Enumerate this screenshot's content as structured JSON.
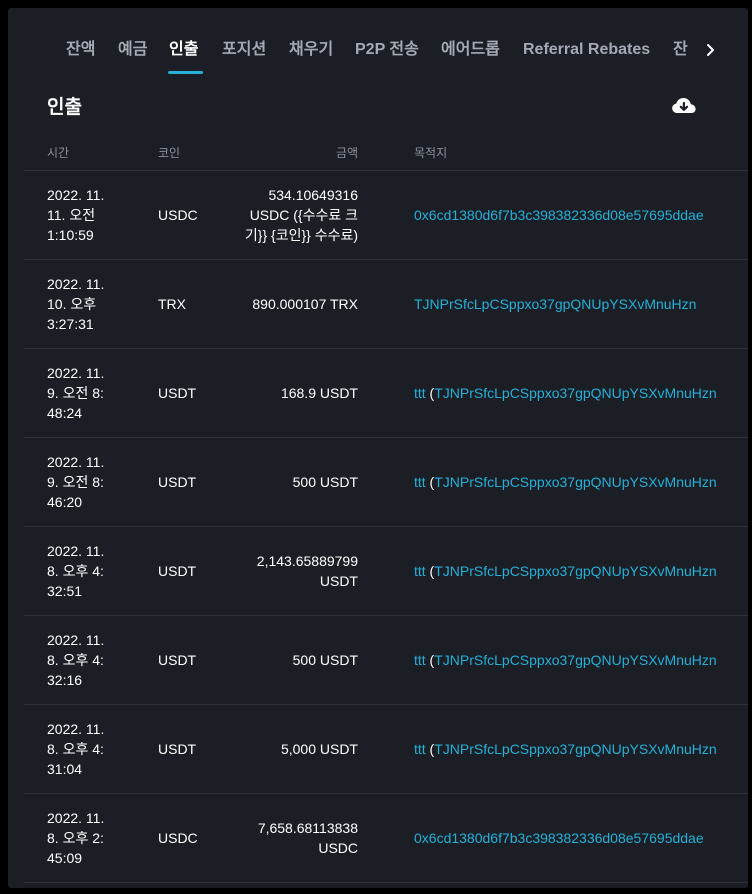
{
  "tabs": [
    {
      "label": "잔액"
    },
    {
      "label": "예금"
    },
    {
      "label": "인출"
    },
    {
      "label": "포지션"
    },
    {
      "label": "채우기"
    },
    {
      "label": "P2P 전송"
    },
    {
      "label": "에어드롭"
    },
    {
      "label": "Referral Rebates"
    },
    {
      "label": "잔"
    }
  ],
  "active_tab": "인출",
  "section_title": "인출",
  "icons": {
    "download": "cloud-download-icon",
    "next": "chevron-right-icon"
  },
  "colors": {
    "accent": "#25b0d8",
    "background": "#1b1e25",
    "text": "#ffffff",
    "muted": "#8b919d"
  },
  "table": {
    "headers": {
      "time": "시간",
      "coin": "코인",
      "amount": "금액",
      "destination": "목적지"
    },
    "rows": [
      {
        "time": "2022. 11. 11. 오전 1:10:59",
        "coin": "USDC",
        "amount": "534.10649316 USDC ({수수료 크기}} {코인}} 수수료)",
        "dest_label": "",
        "dest_open": "",
        "dest_address": "0x6cd1380d6f7b3c398382336d08e57695ddae"
      },
      {
        "time": "2022. 11. 10. 오후 3:27:31",
        "coin": "TRX",
        "amount": "890.000107 TRX",
        "dest_label": "",
        "dest_open": "",
        "dest_address": "TJNPrSfcLpCSppxo37gpQNUpYSXvMnuHzn"
      },
      {
        "time": "2022. 11. 9. 오전 8:48:24",
        "coin": "USDT",
        "amount": "168.9 USDT",
        "dest_label": "ttt",
        "dest_open": " (",
        "dest_address": "TJNPrSfcLpCSppxo37gpQNUpYSXvMnuHzn"
      },
      {
        "time": "2022. 11. 9. 오전 8:46:20",
        "coin": "USDT",
        "amount": "500 USDT",
        "dest_label": "ttt",
        "dest_open": " (",
        "dest_address": "TJNPrSfcLpCSppxo37gpQNUpYSXvMnuHzn"
      },
      {
        "time": "2022. 11. 8. 오후 4:32:51",
        "coin": "USDT",
        "amount": "2,143.65889799 USDT",
        "dest_label": "ttt",
        "dest_open": " (",
        "dest_address": "TJNPrSfcLpCSppxo37gpQNUpYSXvMnuHzn"
      },
      {
        "time": "2022. 11. 8. 오후 4:32:16",
        "coin": "USDT",
        "amount": "500 USDT",
        "dest_label": "ttt",
        "dest_open": " (",
        "dest_address": "TJNPrSfcLpCSppxo37gpQNUpYSXvMnuHzn"
      },
      {
        "time": "2022. 11. 8. 오후 4:31:04",
        "coin": "USDT",
        "amount": "5,000 USDT",
        "dest_label": "ttt",
        "dest_open": " (",
        "dest_address": "TJNPrSfcLpCSppxo37gpQNUpYSXvMnuHzn"
      },
      {
        "time": "2022. 11. 8. 오후 2:45:09",
        "coin": "USDC",
        "amount": "7,658.68113838 USDC",
        "dest_label": "",
        "dest_open": "",
        "dest_address": "0x6cd1380d6f7b3c398382336d08e57695ddae"
      }
    ]
  }
}
